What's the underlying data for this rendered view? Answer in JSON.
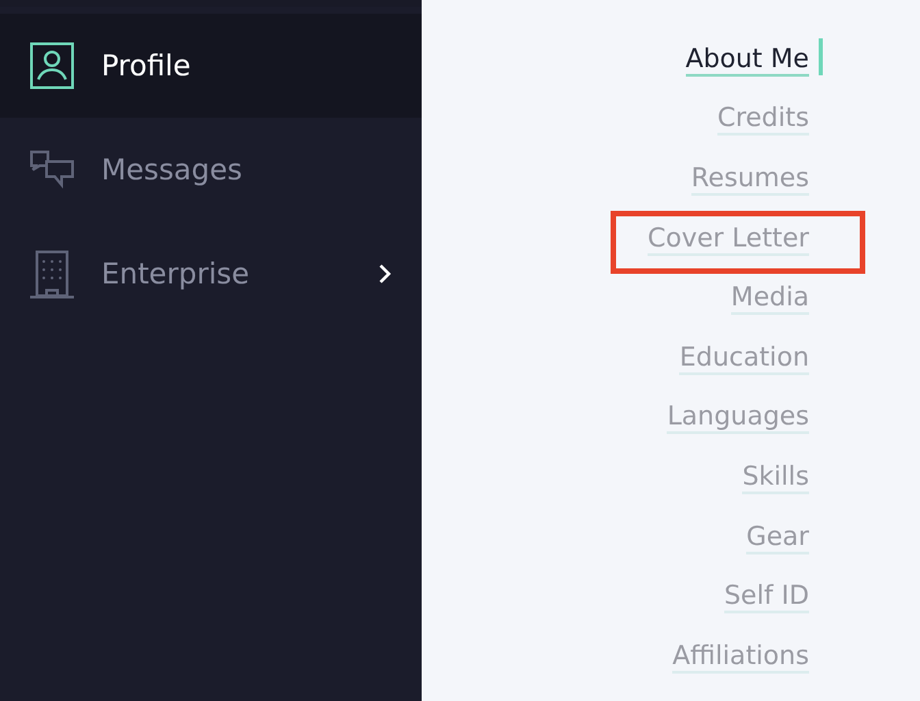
{
  "sidebar": {
    "items": [
      {
        "label": "Profile",
        "kind": "profile",
        "selected": true,
        "has_submenu": false
      },
      {
        "label": "Messages",
        "kind": "messages",
        "selected": false,
        "has_submenu": false
      },
      {
        "label": "Enterprise",
        "kind": "enterprise",
        "selected": false,
        "has_submenu": true
      }
    ]
  },
  "section_nav": {
    "items": [
      {
        "label": "About Me",
        "selected": true,
        "highlighted": false
      },
      {
        "label": "Credits",
        "selected": false,
        "highlighted": false
      },
      {
        "label": "Resumes",
        "selected": false,
        "highlighted": false
      },
      {
        "label": "Cover Letter",
        "selected": false,
        "highlighted": true
      },
      {
        "label": "Media",
        "selected": false,
        "highlighted": false
      },
      {
        "label": "Education",
        "selected": false,
        "highlighted": false
      },
      {
        "label": "Languages",
        "selected": false,
        "highlighted": false
      },
      {
        "label": "Skills",
        "selected": false,
        "highlighted": false
      },
      {
        "label": "Gear",
        "selected": false,
        "highlighted": false
      },
      {
        "label": "Self ID",
        "selected": false,
        "highlighted": false
      },
      {
        "label": "Affiliations",
        "selected": false,
        "highlighted": false
      }
    ]
  }
}
